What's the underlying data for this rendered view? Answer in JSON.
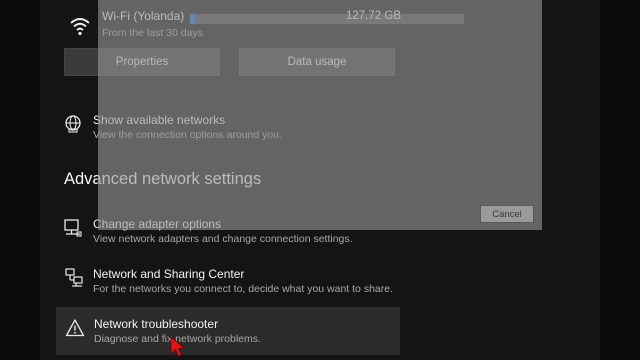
{
  "wifi": {
    "name": "Wi-Fi (Yolanda)",
    "usage": "127.72 GB",
    "period": "From the last 30 days",
    "usage_fraction": 0.02,
    "accent": "#1f6fd6"
  },
  "buttons": {
    "properties": "Properties",
    "data_usage": "Data usage"
  },
  "show_networks": {
    "title": "Show available networks",
    "subtitle": "View the connection options around you."
  },
  "advanced": {
    "heading": "Advanced network settings",
    "items": [
      {
        "title": "Change adapter options",
        "subtitle": "View network adapters and change connection settings.",
        "icon": "network-adapter-icon"
      },
      {
        "title": "Network and Sharing Center",
        "subtitle": "For the networks you connect to, decide what you want to share.",
        "icon": "sharing-center-icon"
      },
      {
        "title": "Network troubleshooter",
        "subtitle": "Diagnose and fix network problems.",
        "icon": "warning-icon"
      }
    ]
  },
  "dialog": {
    "cancel": "Cancel"
  },
  "colors": {
    "cursor": "#e0161b",
    "background": "#000000"
  }
}
